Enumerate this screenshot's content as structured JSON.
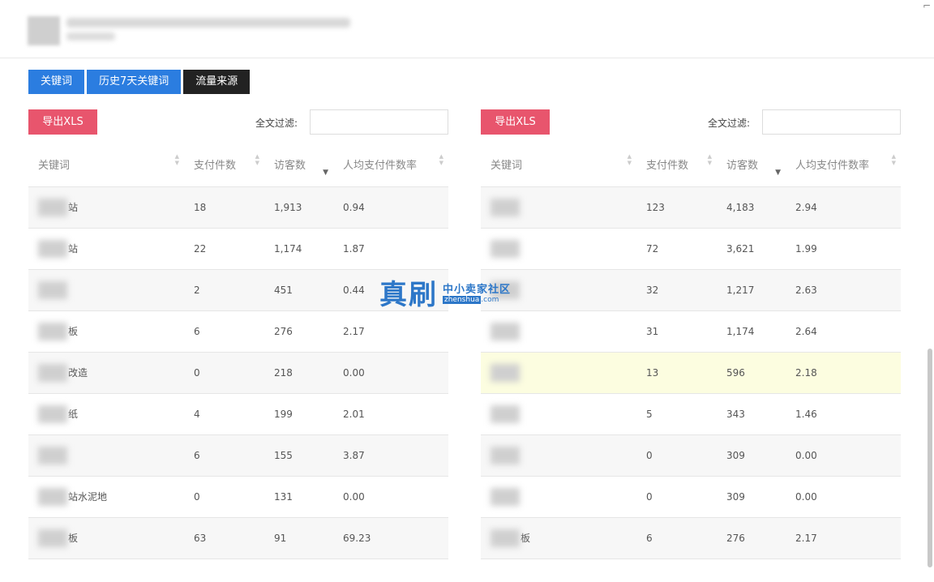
{
  "tabs": [
    "关键词",
    "历史7天关键词",
    "流量来源"
  ],
  "export_label": "导出XLS",
  "filter_label": "全文过滤:",
  "columns": [
    "关键词",
    "支付件数",
    "访客数",
    "人均支付件数率"
  ],
  "left_rows": [
    {
      "kw": "站",
      "pay": "18",
      "visitors": "1,913",
      "rate": "0.94"
    },
    {
      "kw": "站",
      "pay": "22",
      "visitors": "1,174",
      "rate": "1.87"
    },
    {
      "kw": "",
      "pay": "2",
      "visitors": "451",
      "rate": "0.44"
    },
    {
      "kw": "板",
      "pay": "6",
      "visitors": "276",
      "rate": "2.17"
    },
    {
      "kw": "改造",
      "pay": "0",
      "visitors": "218",
      "rate": "0.00"
    },
    {
      "kw": "纸",
      "pay": "4",
      "visitors": "199",
      "rate": "2.01"
    },
    {
      "kw": "",
      "pay": "6",
      "visitors": "155",
      "rate": "3.87"
    },
    {
      "kw": "站水泥地",
      "pay": "0",
      "visitors": "131",
      "rate": "0.00"
    },
    {
      "kw": "板",
      "pay": "63",
      "visitors": "91",
      "rate": "69.23"
    }
  ],
  "right_rows": [
    {
      "kw": "",
      "pay": "123",
      "visitors": "4,183",
      "rate": "2.94"
    },
    {
      "kw": "",
      "pay": "72",
      "visitors": "3,621",
      "rate": "1.99"
    },
    {
      "kw": "",
      "pay": "32",
      "visitors": "1,217",
      "rate": "2.63"
    },
    {
      "kw": "",
      "pay": "31",
      "visitors": "1,174",
      "rate": "2.64"
    },
    {
      "kw": "",
      "pay": "13",
      "visitors": "596",
      "rate": "2.18"
    },
    {
      "kw": "",
      "pay": "5",
      "visitors": "343",
      "rate": "1.46"
    },
    {
      "kw": "",
      "pay": "0",
      "visitors": "309",
      "rate": "0.00"
    },
    {
      "kw": "",
      "pay": "0",
      "visitors": "309",
      "rate": "0.00"
    },
    {
      "kw": "板",
      "pay": "6",
      "visitors": "276",
      "rate": "2.17"
    }
  ],
  "watermark": {
    "main": "真刷",
    "cn": "中小卖家社区",
    "en_box": "zhenshua",
    "en_tail": ".com"
  },
  "highlight_color": "#fcfde0",
  "accent_blue": "#2b7de0",
  "accent_red": "#e8556d"
}
